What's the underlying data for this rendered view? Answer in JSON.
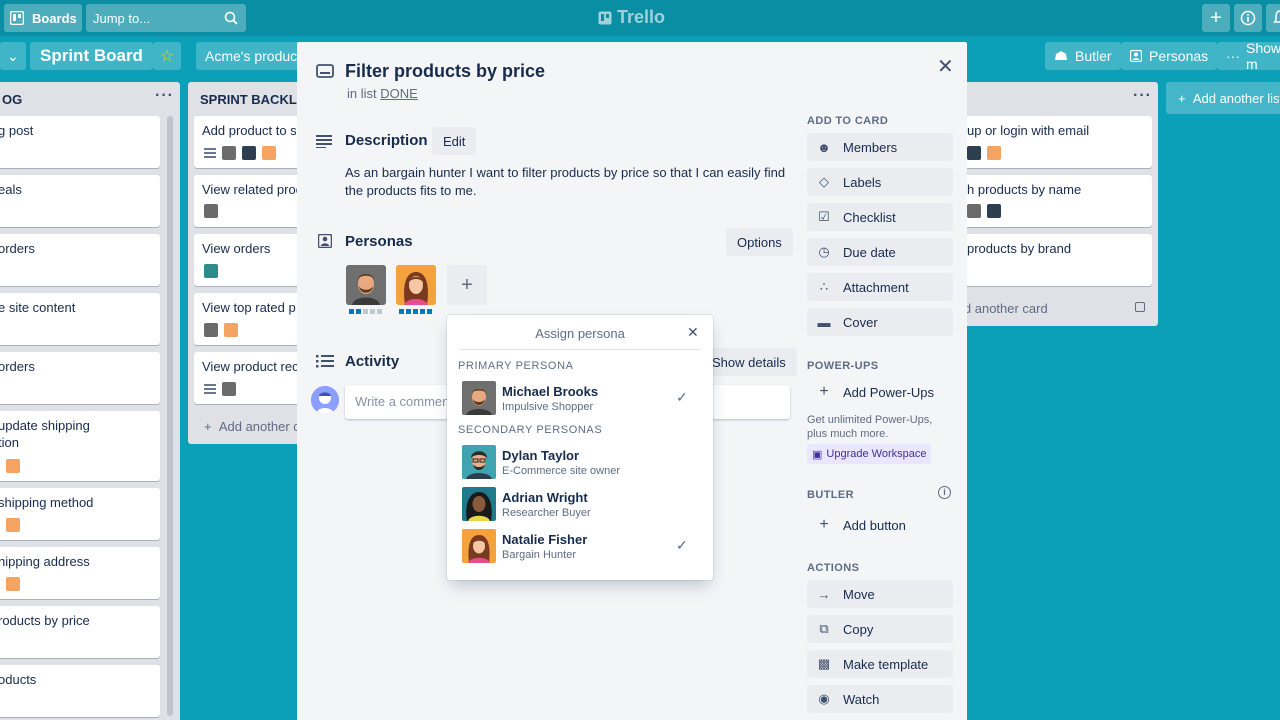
{
  "topbar": {
    "boards_label": "Boards",
    "jump_placeholder": "Jump to...",
    "logo": "Trello"
  },
  "board": {
    "title": "Sprint Board",
    "workspace": "Acme's product",
    "butler": "Butler",
    "personas": "Personas",
    "show": "Show m"
  },
  "lists": {
    "left": {
      "title": "OG",
      "cards": [
        "g post",
        "eals",
        "orders",
        "e site content",
        "orders",
        "update shipping\ntion",
        "shipping method",
        "hipping address",
        "roducts by price",
        "oducts"
      ]
    },
    "mid": {
      "title": "SPRINT BACKLOG",
      "cards": [
        "Add product to s",
        "View related prod",
        "View orders",
        "View top rated p",
        "View product rec"
      ],
      "add_card": "Add another c"
    },
    "right": {
      "cards": [
        "up or login with email",
        "h products by name",
        "products by brand"
      ],
      "add_card": "ld another card"
    },
    "add_list": "Add another list"
  },
  "modal": {
    "title": "Filter products by price",
    "in_list_prefix": "in list",
    "list_name": "DONE",
    "description_title": "Description",
    "edit_label": "Edit",
    "description": "As an bargain hunter I want to filter products by price so that I can easily find the products fits to me.",
    "personas_title": "Personas",
    "options_label": "Options",
    "activity_title": "Activity",
    "show_details": "Show details",
    "comment_placeholder": "Write a comment..."
  },
  "sidebar": {
    "add_to_card": "ADD TO CARD",
    "add_items": [
      {
        "label": "Members",
        "icon": "person-icon"
      },
      {
        "label": "Labels",
        "icon": "tag-icon"
      },
      {
        "label": "Checklist",
        "icon": "checkbox-icon"
      },
      {
        "label": "Due date",
        "icon": "clock-icon"
      },
      {
        "label": "Attachment",
        "icon": "paperclip-icon"
      },
      {
        "label": "Cover",
        "icon": "cover-icon"
      }
    ],
    "powerups_title": "POWER-UPS",
    "add_powerups": "Add Power-Ups",
    "powerups_note": "Get unlimited Power-Ups, plus much more.",
    "upgrade": "Upgrade Workspace",
    "butler_title": "BUTLER",
    "add_button": "Add button",
    "actions_title": "ACTIONS",
    "actions": [
      {
        "label": "Move",
        "icon": "arrow-right-icon"
      },
      {
        "label": "Copy",
        "icon": "copy-icon"
      },
      {
        "label": "Make template",
        "icon": "template-icon"
      },
      {
        "label": "Watch",
        "icon": "eye-icon"
      }
    ]
  },
  "popup": {
    "title": "Assign persona",
    "primary_heading": "PRIMARY PERSONA",
    "secondary_heading": "SECONDARY PERSONAS",
    "primary": {
      "name": "Michael Brooks",
      "role": "Impulsive Shopper",
      "checked": true
    },
    "secondary": [
      {
        "name": "Dylan Taylor",
        "role": "E-Commerce site owner",
        "checked": false
      },
      {
        "name": "Adrian Wright",
        "role": "Researcher Buyer",
        "checked": false
      },
      {
        "name": "Natalie Fisher",
        "role": "Bargain Hunter",
        "checked": true
      }
    ]
  },
  "colors": {
    "board_bg": "#0ba0b8",
    "topbar_bg": "#0a8ea3",
    "accent_blue": "#0079bf",
    "upgrade_purple": "#403294"
  }
}
